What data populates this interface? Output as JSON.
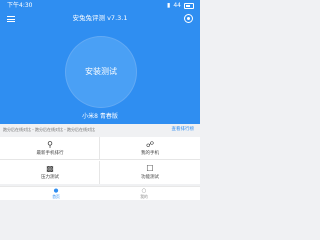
{
  "status_bar": {
    "time": "下午4:30",
    "battery": "44"
  },
  "app": {
    "title": "安兔兔评测 v7.3.1"
  },
  "main": {
    "test_button_label": "安装测试",
    "device_model": "小米8 青春版"
  },
  "strip": {
    "left_text": "跑分后在线对比 - 跑分后在线对比 - 跑分后在线对比",
    "right_text": "查看排行榜"
  },
  "tiles": [
    {
      "label": "最新手机排行",
      "icon": "search-icon"
    },
    {
      "label": "我的手机",
      "icon": "phone-icon"
    },
    {
      "label": "压力测试",
      "icon": "stress-icon"
    },
    {
      "label": "功能测试",
      "icon": "test-icon"
    }
  ],
  "tabbar": {
    "home_label": "首页",
    "mine_label": "我的"
  },
  "colors": {
    "primary": "#2f8ef1",
    "button": "#4aa0f5",
    "background": "#f0f1f3"
  }
}
